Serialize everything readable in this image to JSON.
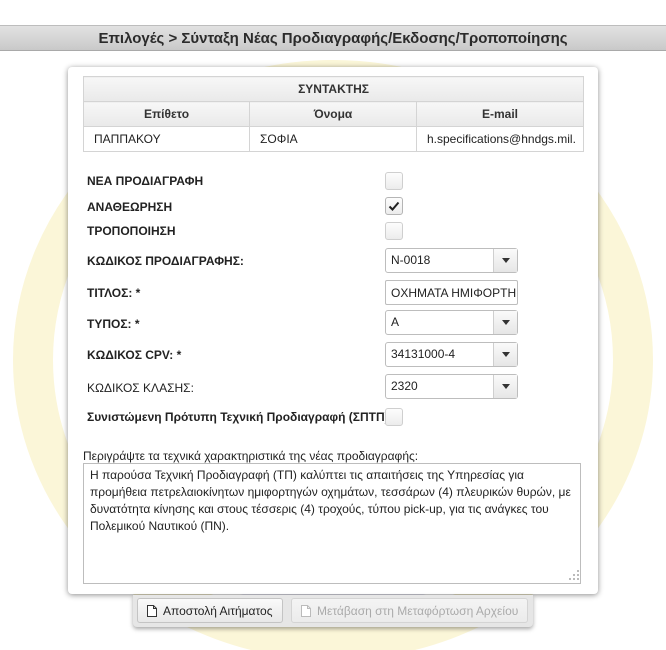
{
  "header": {
    "title": "Επιλογές > Σύνταξη Νέας Προδιαγραφής/Εκδοσης/Τροποποίησης"
  },
  "authors": {
    "caption": "ΣΥΝΤΑΚΤΗΣ",
    "columns": [
      "Επίθετο",
      "Όνομα",
      "E-mail"
    ],
    "row": {
      "surname": "ΠΑΠΠΑΚΟΥ",
      "name": "ΣΟΦΙΑ",
      "email": "h.specifications@hndgs.mil."
    }
  },
  "form": {
    "new_spec": {
      "label": "ΝΕΑ ΠΡΟΔΙΑΓΡΑΦΗ",
      "checked": false
    },
    "revision": {
      "label": "ΑΝΑΘΕΩΡΗΣΗ",
      "checked": true
    },
    "amendment": {
      "label": "ΤΡΟΠΟΠΟΙΗΣΗ",
      "checked": false
    },
    "spec_code": {
      "label": "ΚΩΔΙΚΟΣ ΠΡΟΔΙΑΓΡΑΦΗΣ:",
      "value": "N-0018"
    },
    "title": {
      "label": "ΤΙΤΛΟΣ: *",
      "value": "ΟΧΗΜΑΤΑ ΗΜΙΦΟΡΤΗ"
    },
    "type": {
      "label": "ΤΥΠΟΣ: *",
      "value": "Α"
    },
    "cpv": {
      "label": "ΚΩΔΙΚΟΣ CPV: *",
      "value": "34131000-4"
    },
    "class_code": {
      "label": "ΚΩΔΙΚΟΣ ΚΛΑΣΗΣ:",
      "value": "2320"
    },
    "recommended": {
      "label": "Συνιστώμενη Πρότυπη Τεχνική Προδιαγραφή (ΣΠΤΠ)",
      "checked": false
    },
    "description": {
      "label": "Περιγράψτε τα τεχνικά χαρακτηριστικά της νέας προδιαγραφής:",
      "value": "Η παρούσα Τεχνική Προδιαγραφή (ΤΠ) καλύπτει τις απαιτήσεις της Υπηρεσίας για προμήθεια πετρελαιοκίνητων ημιφορτηγών οχημάτων, τεσσάρων (4) πλευρικών θυρών, με δυνατότητα κίνησης και στους τέσσερις (4) τροχούς, τύπου pick-up, για τις ανάγκες του Πολεμικού Ναυτικού (ΠΝ)."
    }
  },
  "buttons": {
    "submit": "Αποστολή Αιτήματος",
    "upload": "Μετάβαση στη Μεταφόρτωση Αρχείου"
  }
}
